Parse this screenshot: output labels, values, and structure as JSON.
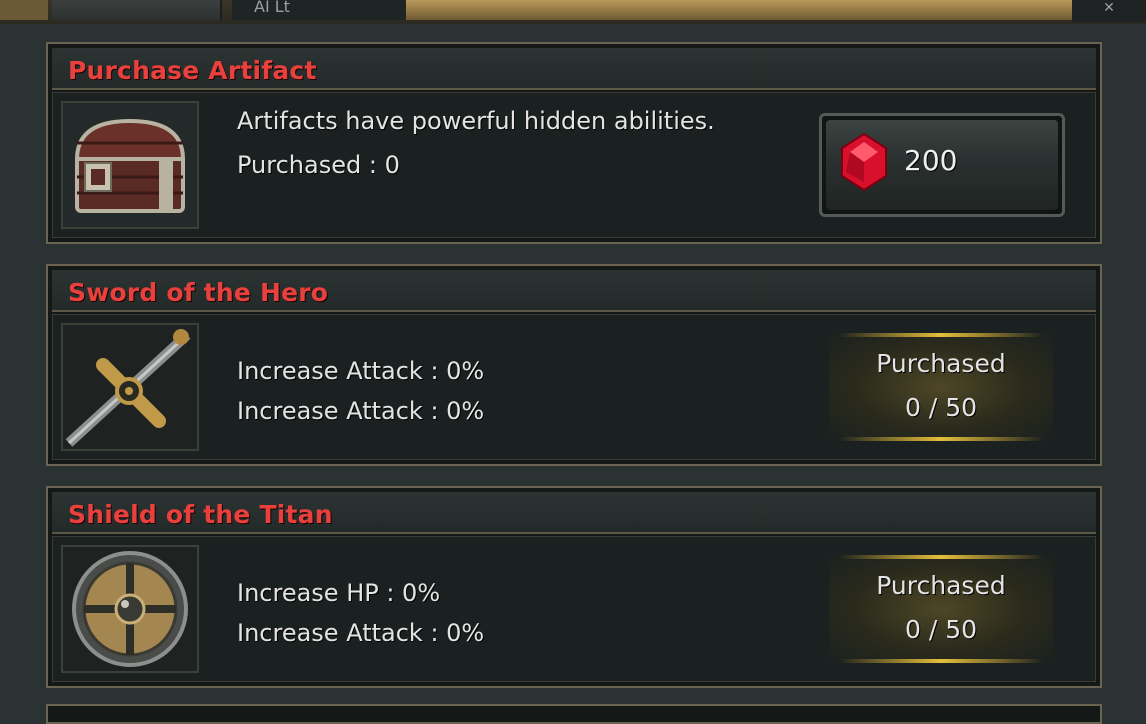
{
  "top_tabs": {
    "tab_b_label": "AI  Lt",
    "corner_label": "✕"
  },
  "cards": [
    {
      "title": "Purchase Artifact",
      "line1": "Artifacts have powerful hidden abilities.",
      "line2": "Purchased : 0",
      "price": "200",
      "price_icon": "red-gem-icon",
      "image": "treasure-chest-icon"
    },
    {
      "title": "Sword of the Hero",
      "line1": "Increase Attack : 0%",
      "line2": "Increase Attack : 0%",
      "status_label": "Purchased",
      "status_count": "0 / 50",
      "image": "sword-icon"
    },
    {
      "title": "Shield of the Titan",
      "line1": "Increase HP : 0%",
      "line2": "Increase Attack : 0%",
      "status_label": "Purchased",
      "status_count": "0 / 50",
      "image": "shield-icon"
    }
  ],
  "colors": {
    "title_red": "#e8403c",
    "gold_glow": "#e6be3c",
    "gem_red": "#d8102c"
  }
}
